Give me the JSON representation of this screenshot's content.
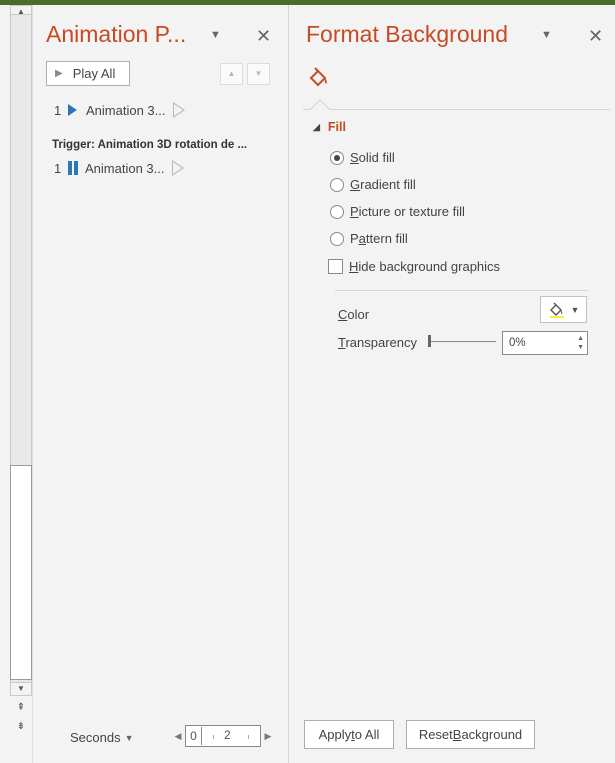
{
  "colors": {
    "accent": "#c64b24",
    "trigger_icon_blue": "#2e75b6",
    "window_strip": "#4a6d2b"
  },
  "animation_pane": {
    "title": "Animation P...",
    "play_all_label": "Play All",
    "items": [
      {
        "number": "1",
        "name": "Animation 3...",
        "icon": "play-triangle-icon"
      }
    ],
    "trigger_label": "Trigger: Animation 3D rotation de ...",
    "trigger_items": [
      {
        "number": "1",
        "name": "Animation 3...",
        "icon": "pause-bars-icon"
      }
    ],
    "seconds_label": "Seconds",
    "timeline_zero": "0",
    "timeline_two": "2"
  },
  "format_background": {
    "title": "Format Background",
    "fill_section_label": "Fill",
    "fill_options": [
      {
        "prefix": "",
        "hotkey": "S",
        "rest": "olid fill",
        "checked": true
      },
      {
        "prefix": "",
        "hotkey": "G",
        "rest": "radient fill",
        "checked": false
      },
      {
        "prefix": "",
        "hotkey": "P",
        "rest": "icture or texture fill",
        "checked": false
      },
      {
        "prefix": "P",
        "hotkey": "a",
        "rest": "ttern fill",
        "checked": false
      }
    ],
    "hide_graphics": {
      "hotkey": "H",
      "rest": "ide background graphics",
      "checked": false
    },
    "color_label": {
      "hotkey": "C",
      "rest": "olor"
    },
    "transparency_label": {
      "hotkey": "T",
      "rest": "ransparency"
    },
    "transparency_value": "0%",
    "apply_all": {
      "prefix": "Apply ",
      "hotkey": "t",
      "rest": "o All"
    },
    "reset_background": {
      "prefix": "Reset ",
      "hotkey": "B",
      "rest": "ackground"
    }
  }
}
